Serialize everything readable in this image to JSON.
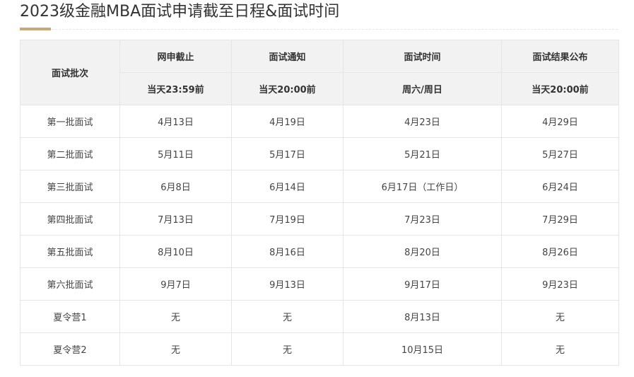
{
  "page": {
    "title": "2023级金融MBA面试申请截至日程&面试时间"
  },
  "table": {
    "first_header": "面试批次",
    "columns": [
      {
        "label": "网申截止",
        "sub": "当天23:59前"
      },
      {
        "label": "面试通知",
        "sub": "当天20:00前"
      },
      {
        "label": "面试时间",
        "sub": "周六/周日"
      },
      {
        "label": "面试结果公布",
        "sub": "当天20:00前"
      }
    ],
    "rows": [
      {
        "batch": "第一批面试",
        "cells": [
          "4月13日",
          "4月19日",
          "4月23日",
          "4月29日"
        ]
      },
      {
        "batch": "第二批面试",
        "cells": [
          "5月11日",
          "5月17日",
          "5月21日",
          "5月27日"
        ]
      },
      {
        "batch": "第三批面试",
        "cells": [
          "6月8日",
          "6月14日",
          "6月17日（工作日）",
          "6月24日"
        ]
      },
      {
        "batch": "第四批面试",
        "cells": [
          "7月13日",
          "7月19日",
          "7月23日",
          "7月29日"
        ]
      },
      {
        "batch": "第五批面试",
        "cells": [
          "8月10日",
          "8月16日",
          "8月20日",
          "8月26日"
        ]
      },
      {
        "batch": "第六批面试",
        "cells": [
          "9月7日",
          "9月13日",
          "9月17日",
          "9月23日"
        ]
      },
      {
        "batch": "夏令营1",
        "cells": [
          "无",
          "无",
          "8月13日",
          "无"
        ]
      },
      {
        "batch": "夏令营2",
        "cells": [
          "无",
          "无",
          "10月15日",
          "无"
        ]
      }
    ]
  },
  "colors": {
    "accent": "#c8a97a",
    "header_bg": "#f2f2f2",
    "border": "#e5e5e5"
  }
}
